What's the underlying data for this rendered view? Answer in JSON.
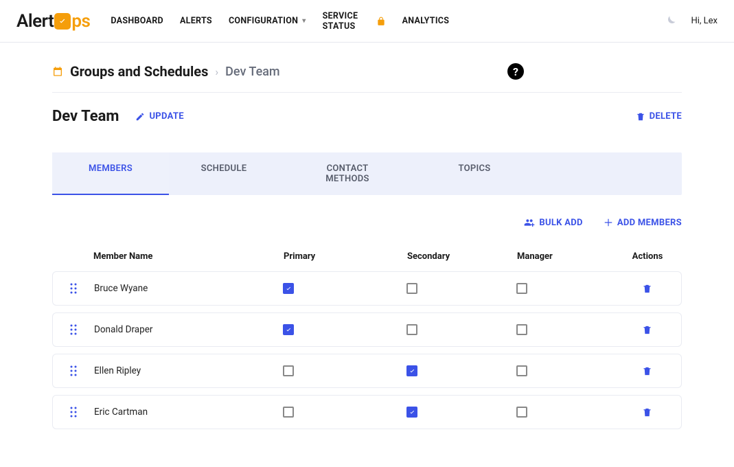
{
  "header": {
    "logo_prefix": "Alert",
    "logo_suffix": "ps",
    "nav": [
      "DASHBOARD",
      "ALERTS",
      "CONFIGURATION",
      "SERVICE STATUS",
      "ANALYTICS"
    ],
    "greeting": "Hi, Lex"
  },
  "breadcrumb": {
    "main": "Groups and Schedules",
    "sub": "Dev Team"
  },
  "page": {
    "title": "Dev Team",
    "update_label": "UPDATE",
    "delete_label": "DELETE"
  },
  "tabs": [
    "MEMBERS",
    "SCHEDULE",
    "CONTACT METHODS",
    "TOPICS"
  ],
  "toolbar": {
    "bulk_add": "BULK ADD",
    "add_members": "ADD MEMBERS"
  },
  "table": {
    "headers": {
      "name": "Member Name",
      "primary": "Primary",
      "secondary": "Secondary",
      "manager": "Manager",
      "actions": "Actions"
    },
    "rows": [
      {
        "name": "Bruce  Wyane",
        "primary": true,
        "secondary": false,
        "manager": false
      },
      {
        "name": "Donald  Draper",
        "primary": true,
        "secondary": false,
        "manager": false
      },
      {
        "name": "Ellen  Ripley",
        "primary": false,
        "secondary": true,
        "manager": false
      },
      {
        "name": "Eric  Cartman",
        "primary": false,
        "secondary": true,
        "manager": false
      }
    ]
  }
}
